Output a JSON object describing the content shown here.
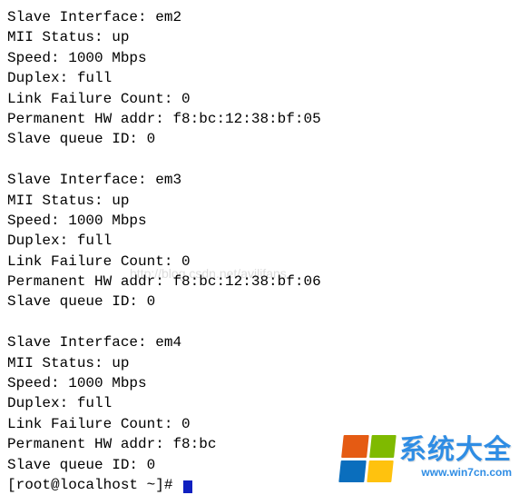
{
  "watermark": "http://blog.csdn.net/avilifans",
  "slaves": [
    {
      "interface_label": "Slave Interface:",
      "interface_value": "em2",
      "mii_label": "MII Status:",
      "mii_value": "up",
      "speed_label": "Speed:",
      "speed_value": "1000 Mbps",
      "duplex_label": "Duplex:",
      "duplex_value": "full",
      "lfc_label": "Link Failure Count:",
      "lfc_value": "0",
      "hw_label": "Permanent HW addr:",
      "hw_value": "f8:bc:12:38:bf:05",
      "queue_label": "Slave queue ID:",
      "queue_value": "0"
    },
    {
      "interface_label": "Slave Interface:",
      "interface_value": "em3",
      "mii_label": "MII Status:",
      "mii_value": "up",
      "speed_label": "Speed:",
      "speed_value": "1000 Mbps",
      "duplex_label": "Duplex:",
      "duplex_value": "full",
      "lfc_label": "Link Failure Count:",
      "lfc_value": "0",
      "hw_label": "Permanent HW addr:",
      "hw_value": "f8:bc:12:38:bf:06",
      "queue_label": "Slave queue ID:",
      "queue_value": "0"
    },
    {
      "interface_label": "Slave Interface:",
      "interface_value": "em4",
      "mii_label": "MII Status:",
      "mii_value": "up",
      "speed_label": "Speed:",
      "speed_value": "1000 Mbps",
      "duplex_label": "Duplex:",
      "duplex_value": "full",
      "lfc_label": "Link Failure Count:",
      "lfc_value": "0",
      "hw_label": "Permanent HW addr:",
      "hw_value": "f8:bc",
      "queue_label": "Slave queue ID:",
      "queue_value": "0"
    }
  ],
  "prompt": "[root@localhost ~]#",
  "brand": {
    "cn": "系统大全",
    "url": "www.win7cn.com"
  }
}
